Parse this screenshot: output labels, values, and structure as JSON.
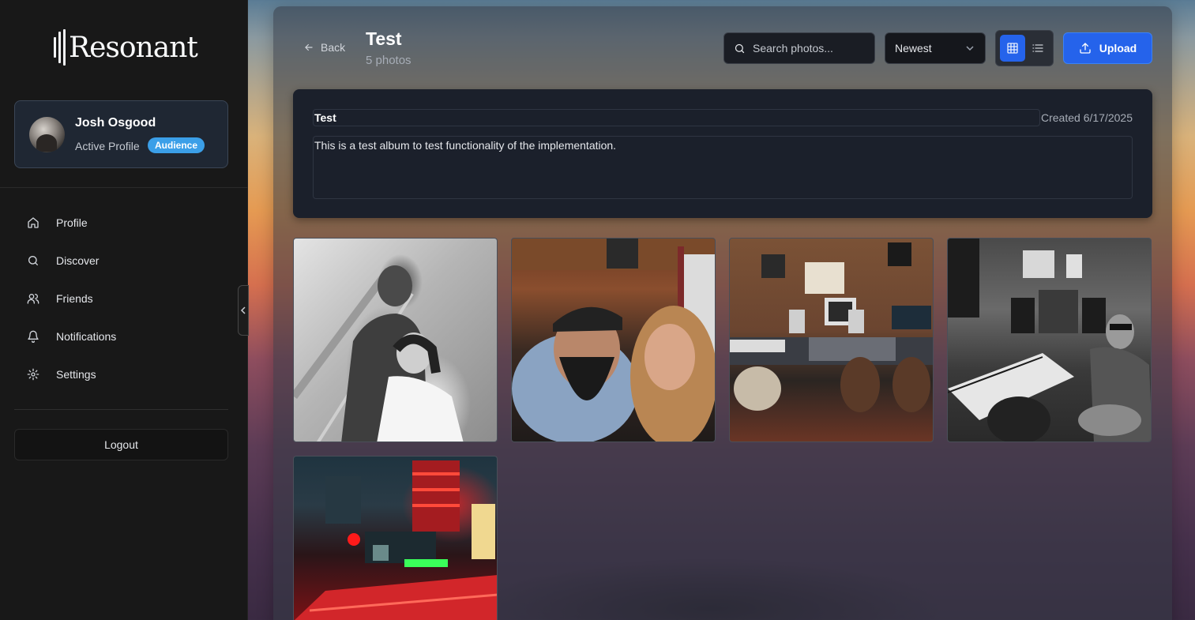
{
  "app": {
    "logo_text": "Resonant"
  },
  "profile": {
    "name": "Josh Osgood",
    "status": "Active Profile",
    "badge": "Audience"
  },
  "nav": [
    {
      "label": "Profile",
      "icon": "home-icon"
    },
    {
      "label": "Discover",
      "icon": "search-icon"
    },
    {
      "label": "Friends",
      "icon": "users-icon"
    },
    {
      "label": "Notifications",
      "icon": "bell-icon"
    },
    {
      "label": "Settings",
      "icon": "gear-icon"
    }
  ],
  "logout_label": "Logout",
  "header": {
    "back_label": "Back",
    "title": "Test",
    "subtitle": "5 photos",
    "search_placeholder": "Search photos...",
    "sort_value": "Newest",
    "upload_label": "Upload",
    "active_view": "grid"
  },
  "album": {
    "name": "Test",
    "created": "Created 6/17/2025",
    "description": "This is a test album to test functionality of the implementation."
  },
  "photos": [
    {
      "subject": "black and white wedding couple on stairs"
    },
    {
      "subject": "couple selfie inside a trolley"
    },
    {
      "subject": "recording studio desk with monitors and keyboard"
    },
    {
      "subject": "black and white studio with man seated at keyboard"
    },
    {
      "subject": "red-lit studio equipment rack"
    }
  ],
  "colors": {
    "accent": "#2563eb",
    "badge": "#3b9fe8",
    "sidebar_bg": "#181818",
    "card_bg": "#1b202b"
  }
}
